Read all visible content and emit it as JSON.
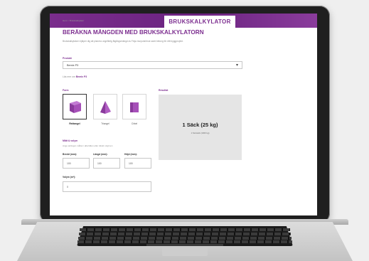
{
  "header": {
    "title": "BRUKSKALKYLATOR"
  },
  "breadcrumb": "Hem > Brukskalkylator",
  "page": {
    "title": "BERÄKNA MÄNGDEN MED BRUKSKALKYLATORN",
    "intro": "Brukskalkylatorn hjälper dig att planera ungefärlig åtgångsmängd av Finja murputs/bruk samt betong för ditt byggprojekt."
  },
  "product": {
    "label": "Produkt",
    "selected": "Bemix P3",
    "read_more_prefix": "Läs mer om",
    "read_more_link": "Bemix P3"
  },
  "form": {
    "label": "Form",
    "options": [
      {
        "name": "Rektangel",
        "selected": true
      },
      {
        "name": "Triangel",
        "selected": false
      },
      {
        "name": "Cirkel",
        "selected": false
      }
    ]
  },
  "sizes": {
    "label": "Mått & volym",
    "hint": "Ange antingen måttet i alla fälten eller direkt volymen",
    "fields": [
      {
        "label": "Bredd (mm):",
        "value": "100"
      },
      {
        "label": "Längd (mm):",
        "value": "100"
      },
      {
        "label": "Höjd (mm):",
        "value": "100"
      }
    ],
    "volume": {
      "label": "Volym (m³):",
      "value": "0"
    }
  },
  "result": {
    "label": "Resultat",
    "amount": "1 Säck (25 kg)",
    "detail": "1 Storsäck (1000 kg)"
  },
  "colors": {
    "accent": "#7d2f90",
    "header_band": "#6b2380",
    "result_bg": "#e5e5e5"
  }
}
